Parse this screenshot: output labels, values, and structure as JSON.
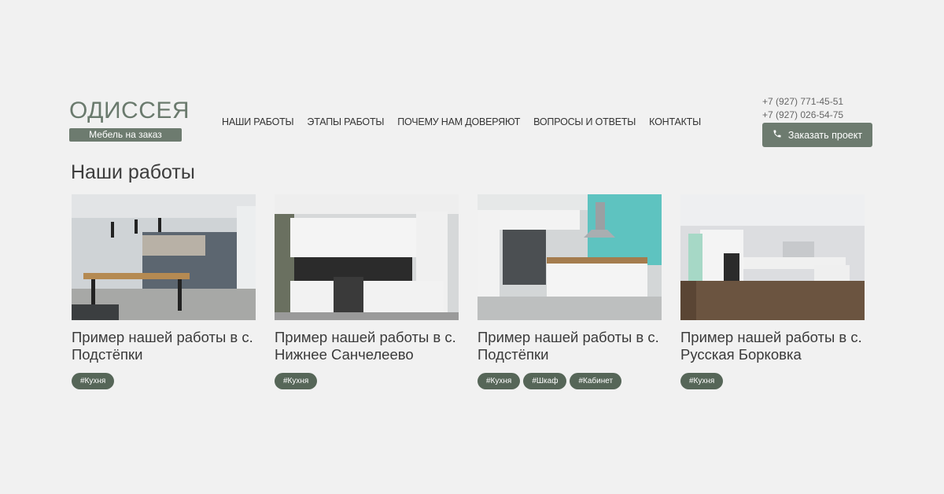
{
  "logo": {
    "title": "ОДИССЕЯ",
    "subtitle": "Мебель на заказ"
  },
  "nav": [
    {
      "label": "НАШИ РАБОТЫ"
    },
    {
      "label": "ЭТАПЫ РАБОТЫ"
    },
    {
      "label": "ПОЧЕМУ НАМ ДОВЕРЯЮТ"
    },
    {
      "label": "ВОПРОСЫ И ОТВЕТЫ"
    },
    {
      "label": "КОНТАКТЫ"
    }
  ],
  "contacts": {
    "phone1": "+7 (927) 771-45-51",
    "phone2": "+7 (927) 026-54-75",
    "order_label": "Заказать проект",
    "order_icon": "phone-icon"
  },
  "section_title": "Наши работы",
  "cards": [
    {
      "title": "Пример нашей работы в с. Подстёпки",
      "tags": [
        "#Кухня"
      ]
    },
    {
      "title": "Пример нашей работы в с. Нижнее Санчелеево",
      "tags": [
        "#Кухня"
      ]
    },
    {
      "title": "Пример нашей работы в с. Подстёпки",
      "tags": [
        "#Кухня",
        "#Шкаф",
        "#Кабинет"
      ]
    },
    {
      "title": "Пример нашей работы в с. Русская Борковка",
      "tags": [
        "#Кухня"
      ]
    }
  ],
  "colors": {
    "accent": "#6d7b6f",
    "tag": "#566658",
    "background": "#f1f1f1"
  }
}
